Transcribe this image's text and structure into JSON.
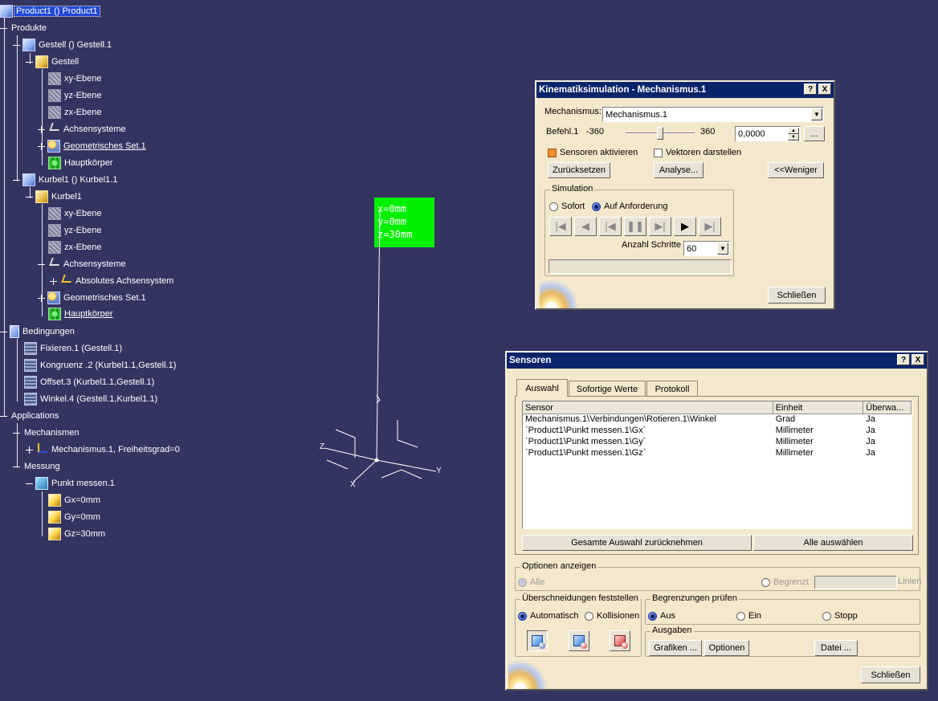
{
  "tree": {
    "root": "Product1 () Product1",
    "produkte": "Produkte",
    "gestell": "Gestell () Gestell.1",
    "gestell_part": "Gestell",
    "gestell_xy": "xy-Ebene",
    "gestell_yz": "yz-Ebene",
    "gestell_zx": "zx-Ebene",
    "gestell_axes": "Achsensysteme",
    "gestell_geoset": "Geometrisches Set.1",
    "gestell_body": "Hauptkörper",
    "kurbel": "Kurbel1 () Kurbel1.1",
    "kurbel_part": "Kurbel1",
    "kurbel_xy": "xy-Ebene",
    "kurbel_yz": "yz-Ebene",
    "kurbel_zx": "zx-Ebene",
    "kurbel_axes": "Achsensysteme",
    "kurbel_abs_axes": "Absolutes Achsensystem",
    "kurbel_geoset": "Geometrisches Set.1",
    "kurbel_body": "Hauptkörper",
    "bedingungen": "Bedingungen",
    "fixieren": "Fixieren.1 (Gestell.1)",
    "kongruenz": "Kongruenz .2 (Kurbel1.1,Gestell.1)",
    "offset": "Offset.3 (Kurbel1.1,Gestell.1)",
    "winkel": "Winkel.4 (Gestell.1,Kurbel1.1)",
    "applications": "Applications",
    "mechanismen": "Mechanismen",
    "mechanismus": "Mechanismus.1, Freiheitsgrad=0",
    "messung": "Messung",
    "punkt": "Punkt messen.1",
    "gx": "Gx=0mm",
    "gy": "Gy=0mm",
    "gz": "Gz=30mm"
  },
  "viewport": {
    "measure_x": "x=0mm",
    "measure_y": "y=0mm",
    "measure_z": "z=30mm",
    "axis_x": "X",
    "axis_y": "Y",
    "axis_z": "Z"
  },
  "kin": {
    "title": "Kinematiksimulation - Mechanismus.1",
    "help": "?",
    "close_x": "X",
    "mech_label": "Mechanismus:",
    "mech_value": "Mechanismus.1",
    "cmd_label": "Befehl.1",
    "cmd_min": "-360",
    "cmd_max": "360",
    "cmd_value": "0,0000",
    "ellipsis": "...",
    "sensors_label": "Sensoren aktivieren",
    "vectors_label": "Vektoren darstellen",
    "reset_btn": "Zurücksetzen",
    "analyse_btn": "Analyse...",
    "less_btn": "<<Weniger",
    "sim_group": "Simulation",
    "sofort": "Sofort",
    "auf_anf": "Auf Anforderung",
    "steps_label": "Anzahl Schritte",
    "steps_value": "60",
    "close_btn": "Schließen",
    "slider_fraction": 0.5
  },
  "sensors": {
    "title": "Sensoren",
    "help": "?",
    "close_x": "X",
    "tabs": [
      "Auswahl",
      "Sofortige Werte",
      "Protokoll"
    ],
    "col_sensor": "Sensor",
    "col_unit": "Einheit",
    "col_watch": "Überwa...",
    "rows": [
      {
        "sensor": "Mechanismus.1\\Verbindungen\\Rotieren.1\\Winkel",
        "unit": "Grad",
        "watch": "Ja"
      },
      {
        "sensor": "`Product1\\Punkt messen.1\\Gx`",
        "unit": "Millimeter",
        "watch": "Ja"
      },
      {
        "sensor": "`Product1\\Punkt messen.1\\Gy`",
        "unit": "Millimeter",
        "watch": "Ja"
      },
      {
        "sensor": "`Product1\\Punkt messen.1\\Gz`",
        "unit": "Millimeter",
        "watch": "Ja"
      }
    ],
    "deselect_all": "Gesamte Auswahl zurücknehmen",
    "select_all": "Alle auswählen",
    "options_group": "Optionen anzeigen",
    "alle": "Alle",
    "begrenzt": "Begrenzt",
    "linien": "Linien",
    "clash_group": "Überschneidungen feststellen",
    "automatisch": "Automatisch",
    "kollisionen": "Kollisionen",
    "limits_group": "Begrenzungen prüfen",
    "aus": "Aus",
    "ein": "Ein",
    "stopp": "Stopp",
    "outputs_group": "Ausgaben",
    "grafiken_btn": "Grafiken ...",
    "optionen_btn": "Optionen",
    "datei_btn": "Datei ...",
    "close_btn": "Schließen"
  }
}
